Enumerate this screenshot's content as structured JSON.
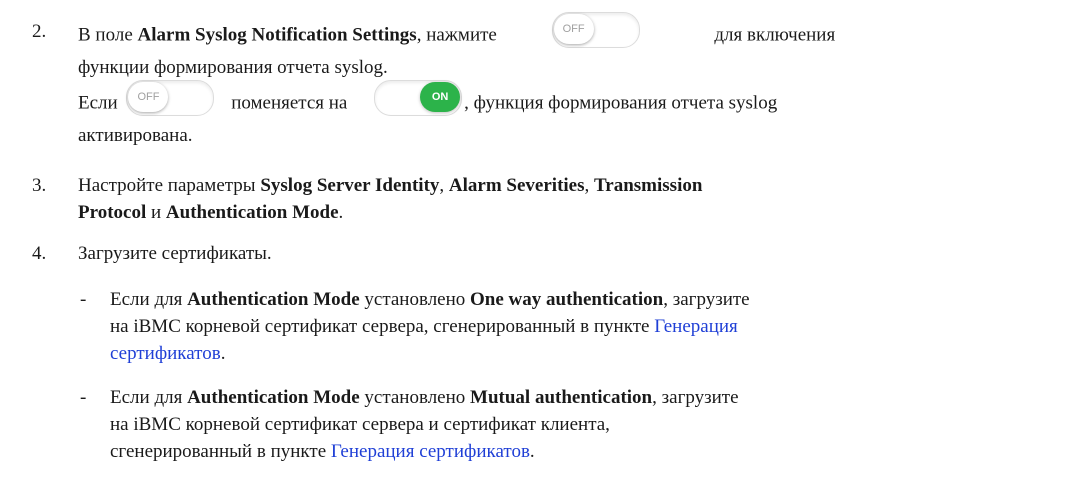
{
  "step2": {
    "number": "2.",
    "text_before": "В поле ",
    "bold_field": "Alarm Syslog Notification Settings",
    "text_mid": ", нажмите ",
    "text_after": " для включения",
    "line2": "функции формирования отчета syslog."
  },
  "step2_note": {
    "prefix": "Если ",
    "mid": " поменяется на ",
    "suffix": ", функция формирования отчета syslog",
    "line2": "активирована."
  },
  "toggle_off_label": "OFF",
  "toggle_on_label": "ON",
  "step3": {
    "number": "3.",
    "t1": "Настройте параметры ",
    "b1": "Syslog Server Identity",
    "t2": ", ",
    "b2": "Alarm Severities",
    "t3": ", ",
    "b3": "Transmission",
    "b4": "Protocol",
    "t4": " и ",
    "b5": "Authentication Mode",
    "t5": "."
  },
  "step4": {
    "number": "4.",
    "text": "Загрузите сертификаты."
  },
  "bullet1": {
    "dash": "-",
    "t1": "Если для ",
    "b1": "Authentication Mode",
    "t2": " установлено ",
    "b2": "One way authentication",
    "t3": ", загрузите",
    "line2_text": "на iBMC корневой сертификат сервера, сгенерированный в пункте ",
    "link_part1": "Генерация",
    "link_part2": "сертификатов",
    "end": "."
  },
  "bullet2": {
    "dash": "-",
    "t1": "Если для ",
    "b1": "Authentication Mode",
    "t2": " установлено ",
    "b2": "Mutual authentication",
    "t3": ", загрузите",
    "line2": "на iBMC корневой сертификат сервера и сертификат клиента,",
    "line3_text": "сгенерированный в пункте ",
    "link": "Генерация сертификатов",
    "end": "."
  },
  "colors": {
    "link": "#1f3fd6",
    "toggle_on": "#2cb34a"
  }
}
